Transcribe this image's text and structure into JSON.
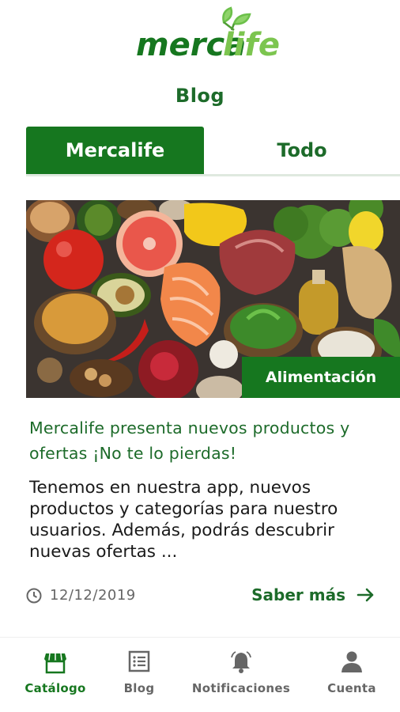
{
  "brand": {
    "logo_text": "mercalife",
    "accent": "#16771f"
  },
  "header": {
    "title": "Blog"
  },
  "tabs": [
    {
      "label": "Mercalife",
      "active": true
    },
    {
      "label": "Todo",
      "active": false
    }
  ],
  "post": {
    "category": "Alimentación",
    "title": "Mercalife presenta nuevos productos y ofertas ¡No te lo pierdas!",
    "excerpt": "Tenemos en nuestra app, nuevos productos y categorías para nuestro usuarios. Además, podrás descubrir nuevas ofertas ...",
    "date": "12/12/2019",
    "read_more": "Saber más"
  },
  "bottom_nav": [
    {
      "label": "Catálogo",
      "icon": "store-icon",
      "active": true
    },
    {
      "label": "Blog",
      "icon": "list-icon",
      "active": false
    },
    {
      "label": "Notificaciones",
      "icon": "bell-icon",
      "active": false
    },
    {
      "label": "Cuenta",
      "icon": "user-icon",
      "active": false
    }
  ]
}
